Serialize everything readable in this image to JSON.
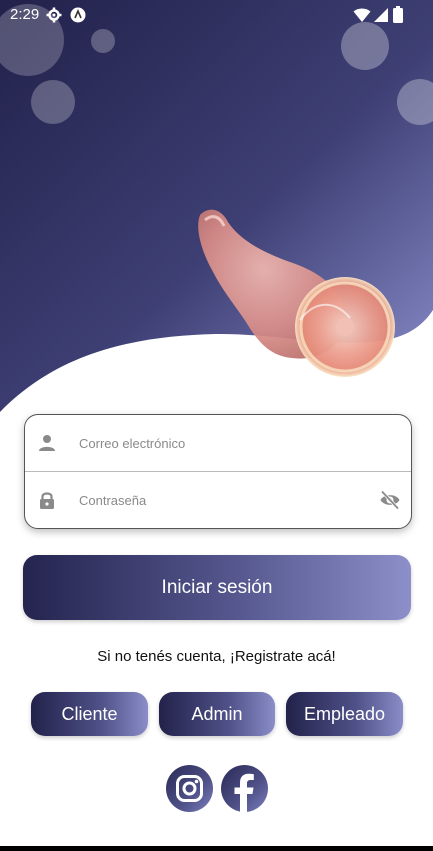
{
  "status_bar": {
    "time": "2:29",
    "icons": [
      "settings-icon",
      "app-icon",
      "wifi-icon",
      "signal-icon",
      "battery-icon"
    ]
  },
  "hero": {
    "image": "ham-leg-illustration",
    "colors": {
      "gradient_top": "#25244f",
      "gradient_bottom": "#8a8ecb"
    }
  },
  "login_form": {
    "email_placeholder": "Correo electrónico",
    "password_placeholder": "Contraseña",
    "email_icon": "person-icon",
    "password_icon": "lock-icon",
    "toggle_icon": "eye-off-icon"
  },
  "login_button": {
    "label": "Iniciar sesión"
  },
  "register_link": {
    "label": "Si no tenés cuenta, ¡Registrate acá!"
  },
  "role_buttons": [
    {
      "label": "Cliente"
    },
    {
      "label": "Admin"
    },
    {
      "label": "Empleado"
    }
  ],
  "social": [
    {
      "icon": "instagram-icon"
    },
    {
      "icon": "facebook-icon"
    }
  ],
  "colors": {
    "accent": "#25244f",
    "accent_light": "#8c8fc9"
  }
}
